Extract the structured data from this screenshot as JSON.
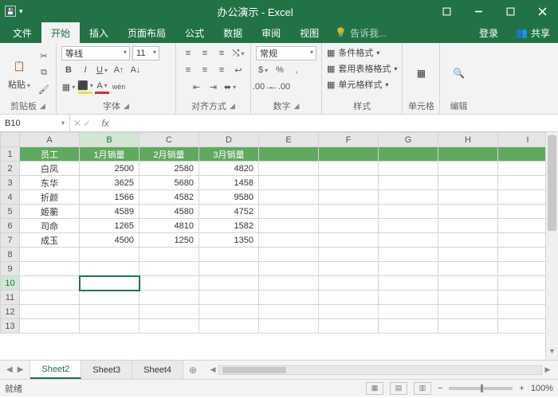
{
  "window": {
    "title": "办公演示 - Excel"
  },
  "tabs": {
    "file": "文件",
    "home": "开始",
    "insert": "插入",
    "layout": "页面布局",
    "formulas": "公式",
    "data": "数据",
    "review": "审阅",
    "view": "视图",
    "tell": "告诉我...",
    "login": "登录",
    "share": "共享"
  },
  "ribbon": {
    "clipboard": {
      "paste": "粘贴",
      "label": "剪贴板"
    },
    "font": {
      "name": "等线",
      "size": "11",
      "label": "字体"
    },
    "align": {
      "label": "对齐方式"
    },
    "number": {
      "format": "常规",
      "label": "数字"
    },
    "styles": {
      "cond": "条件格式",
      "table": "套用表格格式",
      "cell": "单元格样式",
      "label": "样式"
    },
    "cells": {
      "label": "单元格"
    },
    "editing": {
      "label": "编辑"
    }
  },
  "namebox": "B10",
  "formula": "",
  "columns": [
    "A",
    "B",
    "C",
    "D",
    "E",
    "F",
    "G",
    "H",
    "I"
  ],
  "row_count": 13,
  "header_row": [
    "员工",
    "1月销量",
    "2月销量",
    "3月销量"
  ],
  "chart_data": {
    "type": "table",
    "title": "",
    "columns": [
      "员工",
      "1月销量",
      "2月销量",
      "3月销量"
    ],
    "rows": [
      {
        "员工": "白凤",
        "1月销量": 2500,
        "2月销量": 2580,
        "3月销量": 4820
      },
      {
        "员工": "东华",
        "1月销量": 3625,
        "2月销量": 5680,
        "3月销量": 1458
      },
      {
        "员工": "折颜",
        "1月销量": 1566,
        "2月销量": 4582,
        "3月销量": 9580
      },
      {
        "员工": "姬蘅",
        "1月销量": 4589,
        "2月销量": 4580,
        "3月销量": 4752
      },
      {
        "员工": "司命",
        "1月销量": 1265,
        "2月销量": 4810,
        "3月销量": 1582
      },
      {
        "员工": "成玉",
        "1月销量": 4500,
        "2月销量": 1250,
        "3月销量": 1350
      }
    ]
  },
  "sheets": {
    "s2": "Sheet2",
    "s3": "Sheet3",
    "s4": "Sheet4"
  },
  "status": {
    "ready": "就绪",
    "zoom": "100%"
  },
  "selection": {
    "row": 10,
    "col": "B"
  }
}
